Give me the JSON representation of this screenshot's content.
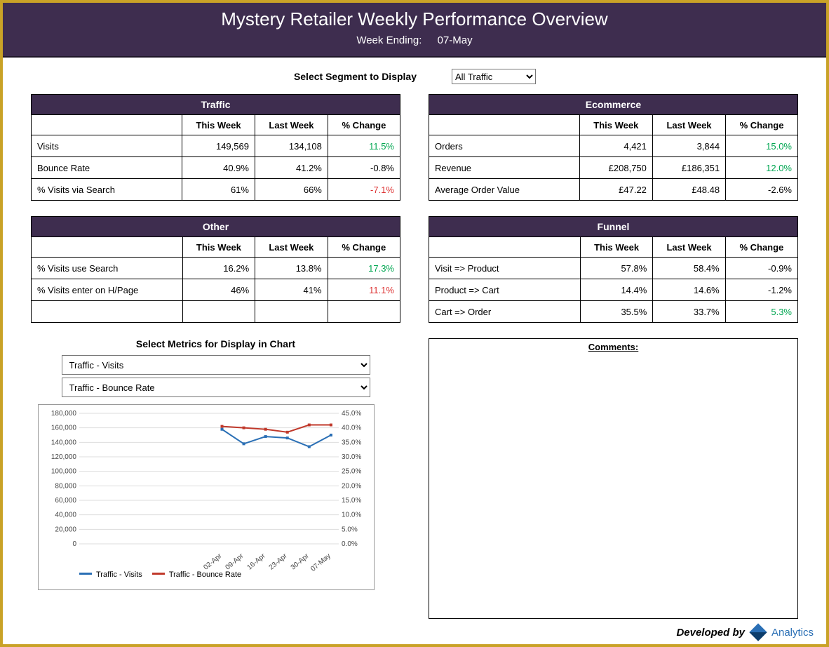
{
  "header": {
    "title": "Mystery Retailer Weekly Performance Overview",
    "week_ending_label": "Week Ending:",
    "week_ending_value": "07-May"
  },
  "segment": {
    "label": "Select Segment to Display",
    "value": "All Traffic"
  },
  "cols": {
    "this_week": "This Week",
    "last_week": "Last Week",
    "change": "% Change"
  },
  "tables": {
    "traffic": {
      "title": "Traffic",
      "rows": [
        {
          "metric": "Visits",
          "tw": "149,569",
          "lw": "134,108",
          "chg": "11.5%",
          "cls": "pos"
        },
        {
          "metric": "Bounce Rate",
          "tw": "40.9%",
          "lw": "41.2%",
          "chg": "-0.8%",
          "cls": ""
        },
        {
          "metric": "% Visits via Search",
          "tw": "61%",
          "lw": "66%",
          "chg": "-7.1%",
          "cls": "neg"
        }
      ]
    },
    "ecommerce": {
      "title": "Ecommerce",
      "rows": [
        {
          "metric": "Orders",
          "tw": "4,421",
          "lw": "3,844",
          "chg": "15.0%",
          "cls": "pos"
        },
        {
          "metric": "Revenue",
          "tw": "£208,750",
          "lw": "£186,351",
          "chg": "12.0%",
          "cls": "pos"
        },
        {
          "metric": "Average Order Value",
          "tw": "£47.22",
          "lw": "£48.48",
          "chg": "-2.6%",
          "cls": ""
        }
      ]
    },
    "other": {
      "title": "Other",
      "rows": [
        {
          "metric": "% Visits use Search",
          "tw": "16.2%",
          "lw": "13.8%",
          "chg": "17.3%",
          "cls": "pos"
        },
        {
          "metric": "% Visits enter on H/Page",
          "tw": "46%",
          "lw": "41%",
          "chg": "11.1%",
          "cls": "neg"
        },
        {
          "metric": "",
          "tw": "",
          "lw": "",
          "chg": "",
          "cls": ""
        }
      ]
    },
    "funnel": {
      "title": "Funnel",
      "rows": [
        {
          "metric": "Visit => Product",
          "tw": "57.8%",
          "lw": "58.4%",
          "chg": "-0.9%",
          "cls": ""
        },
        {
          "metric": "Product => Cart",
          "tw": "14.4%",
          "lw": "14.6%",
          "chg": "-1.2%",
          "cls": ""
        },
        {
          "metric": "Cart => Order",
          "tw": "35.5%",
          "lw": "33.7%",
          "chg": "5.3%",
          "cls": "pos"
        }
      ]
    }
  },
  "chart_selector": {
    "title": "Select Metrics for Display in Chart",
    "metric1": "Traffic - Visits",
    "metric2": "Traffic - Bounce Rate"
  },
  "chart_data": {
    "type": "line",
    "categories": [
      "02-Apr",
      "09-Apr",
      "16-Apr",
      "23-Apr",
      "30-Apr",
      "07-May"
    ],
    "series": [
      {
        "name": "Traffic - Visits",
        "color": "#2a6fb5",
        "axis": "left",
        "values": [
          158000,
          138000,
          148000,
          146000,
          134000,
          150000
        ]
      },
      {
        "name": "Traffic - Bounce Rate",
        "color": "#c0392b",
        "axis": "right",
        "values": [
          40.5,
          40.0,
          39.5,
          38.5,
          41.0,
          41.0
        ]
      }
    ],
    "y_left": {
      "min": 0,
      "max": 180000,
      "step": 20000
    },
    "y_right": {
      "min": 0,
      "max": 45,
      "step": 5,
      "suffix": "%"
    }
  },
  "comments": {
    "title": "Comments:"
  },
  "footer": {
    "developed_by": "Developed by",
    "brand": "Analytics"
  }
}
